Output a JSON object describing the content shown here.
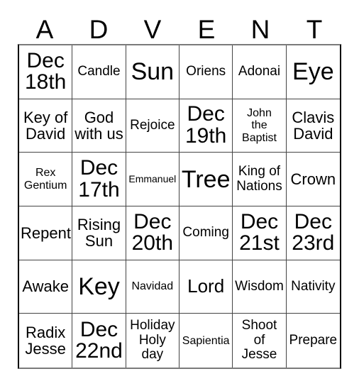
{
  "card": {
    "title": "ADVENT",
    "header_letters": [
      "A",
      "D",
      "V",
      "E",
      "N",
      "T"
    ],
    "columns": 6,
    "rows": 6,
    "colors": {
      "text": "#000000",
      "background": "#ffffff",
      "grid_line": "#444444",
      "outer_border": "#000000"
    },
    "cells": [
      {
        "text": "Dec\n18th",
        "size": "fs-xxl"
      },
      {
        "text": "Candle",
        "size": "fs-md"
      },
      {
        "text": "Sun",
        "size": "fs-huge"
      },
      {
        "text": "Oriens",
        "size": "fs-md"
      },
      {
        "text": "Adonai",
        "size": "fs-md"
      },
      {
        "text": "Eye",
        "size": "fs-huge"
      },
      {
        "text": "Key of\nDavid",
        "size": "fs-lg"
      },
      {
        "text": "God\nwith us",
        "size": "fs-lg"
      },
      {
        "text": "Rejoice",
        "size": "fs-md"
      },
      {
        "text": "Dec\n19th",
        "size": "fs-xxl"
      },
      {
        "text": "John\nthe\nBaptist",
        "size": "fs-sm"
      },
      {
        "text": "Clavis\nDavid",
        "size": "fs-lg"
      },
      {
        "text": "Rex\nGentium",
        "size": "fs-sm"
      },
      {
        "text": "Dec\n17th",
        "size": "fs-xxl"
      },
      {
        "text": "Emmanuel",
        "size": "fs-xs"
      },
      {
        "text": "Tree",
        "size": "fs-huge"
      },
      {
        "text": "King of\nNations",
        "size": "fs-md"
      },
      {
        "text": "Crown",
        "size": "fs-lg"
      },
      {
        "text": "Repent",
        "size": "fs-lg"
      },
      {
        "text": "Rising\nSun",
        "size": "fs-lg"
      },
      {
        "text": "Dec\n20th",
        "size": "fs-xxl"
      },
      {
        "text": "Coming",
        "size": "fs-md"
      },
      {
        "text": "Dec\n21st",
        "size": "fs-xxl"
      },
      {
        "text": "Dec\n23rd",
        "size": "fs-xxl"
      },
      {
        "text": "Awake",
        "size": "fs-lg"
      },
      {
        "text": "Key",
        "size": "fs-huge"
      },
      {
        "text": "Navidad",
        "size": "fs-sm"
      },
      {
        "text": "Lord",
        "size": "fs-xl"
      },
      {
        "text": "Wisdom",
        "size": "fs-md"
      },
      {
        "text": "Nativity",
        "size": "fs-md"
      },
      {
        "text": "Radix\nJesse",
        "size": "fs-lg"
      },
      {
        "text": "Dec\n22nd",
        "size": "fs-xxl"
      },
      {
        "text": "Holiday\nHoly\nday",
        "size": "fs-md"
      },
      {
        "text": "Sapientia",
        "size": "fs-sm"
      },
      {
        "text": "Shoot\nof\nJesse",
        "size": "fs-md"
      },
      {
        "text": "Prepare",
        "size": "fs-md"
      }
    ]
  }
}
